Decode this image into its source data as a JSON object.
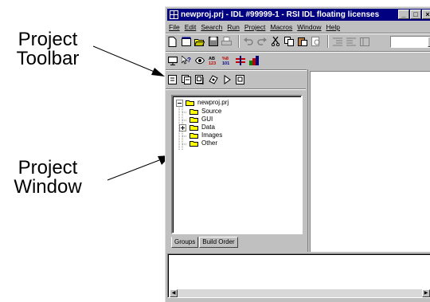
{
  "callouts": {
    "toolbar": [
      "Project",
      "Toolbar"
    ],
    "window": [
      "Project",
      "Window"
    ]
  },
  "window": {
    "title": "newproj.prj - IDL #99999-1 - RSI IDL floating licenses",
    "controls": [
      "minimize",
      "maximize",
      "close"
    ]
  },
  "menu": [
    "File",
    "Edit",
    "Search",
    "Run",
    "Project",
    "Macros",
    "Window",
    "Help"
  ],
  "toolbars": {
    "standard": [
      "new-file-icon",
      "new-project-icon",
      "open-icon",
      "save-icon",
      "print-icon",
      "undo-icon",
      "redo-icon",
      "cut-icon",
      "copy-icon",
      "paste-icon",
      "find-icon",
      "indent-icon",
      "outdent-icon",
      "comment-icon"
    ],
    "second": [
      "monitor-icon",
      "help-pointer-icon",
      "eye-icon",
      "ab-icon",
      "numbers-icon",
      "chart-icon",
      "palette-icon"
    ],
    "project": [
      "project-new-icon",
      "project-add-icon",
      "project-files-icon",
      "project-build-icon",
      "project-run-icon",
      "project-props-icon"
    ]
  },
  "tree": {
    "root": "newproj.prj",
    "items": [
      "Source",
      "GUI",
      "Data",
      "Images",
      "Other"
    ]
  },
  "tabs": [
    "Groups",
    "Build Order"
  ],
  "colors": {
    "titlebar": "#000080",
    "face": "#c0c0c0",
    "folder": "#ffff00"
  }
}
